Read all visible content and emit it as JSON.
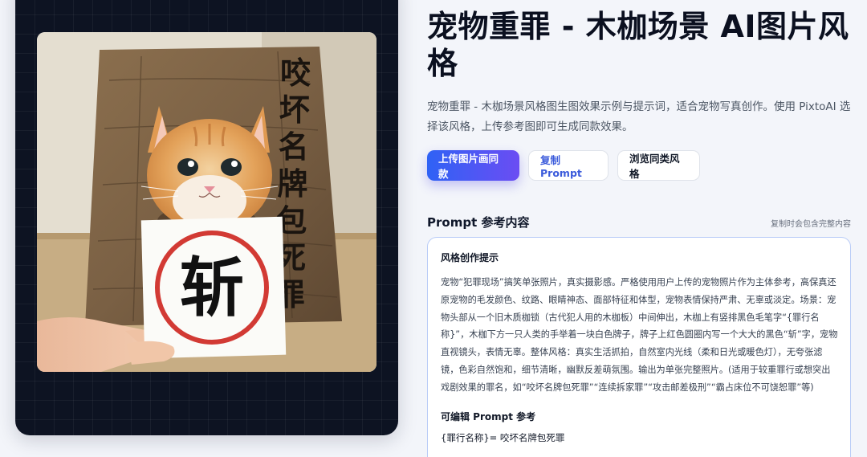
{
  "preview": {
    "board_text": "咬坏名牌包死罪",
    "sign_text": "斩"
  },
  "header": {
    "title": "宠物重罪 - 木枷场景 AI图片风格",
    "description": "宠物重罪 - 木枷场景风格图生图效果示例与提示词，适合宠物写真创作。使用 PixtoAI 选择该风格，上传参考图即可生成同款效果。"
  },
  "actions": {
    "upload_label": "上传图片画同款",
    "copy_label": "复制 Prompt",
    "browse_label": "浏览同类风格"
  },
  "prompt_section": {
    "title": "Prompt 参考内容",
    "hint": "复制时会包含完整内容",
    "style_label": "风格创作提示",
    "style_text": "宠物“犯罪现场”搞笑单张照片，真实摄影感。严格使用用户上传的宠物照片作为主体参考，高保真还原宠物的毛发颜色、纹路、眼睛神态、面部特征和体型，宠物表情保持严肃、无辜或淡定。场景：宠物头部从一个旧木质枷锁（古代犯人用的木枷板）中间伸出，木枷上有竖排黑色毛笔字“{罪行名称}”，木枷下方一只人类的手举着一块白色牌子，牌子上红色圆圈内写一个大大的黑色“斩”字，宠物直视镜头，表情无辜。整体风格：真实生活抓拍，自然室内光线（柔和日光或暖色灯），无夸张滤镜，色彩自然饱和，细节清晰，幽默反差萌氛围。输出为单张完整照片。(适用于较重罪行或想突出戏剧效果的罪名，如“咬坏名牌包死罪”“连续拆家罪”“攻击邮差极刑”“霸占床位不可饶恕罪”等)",
    "editable_label": "可编辑 Prompt 参考",
    "editable_line": "{罪行名称}= 咬坏名牌包死罪"
  },
  "colors": {
    "accent_start": "#2f62f5",
    "accent_end": "#6b4df3",
    "card_bg": "#0d1322",
    "page_bg": "#f3f5fa"
  }
}
